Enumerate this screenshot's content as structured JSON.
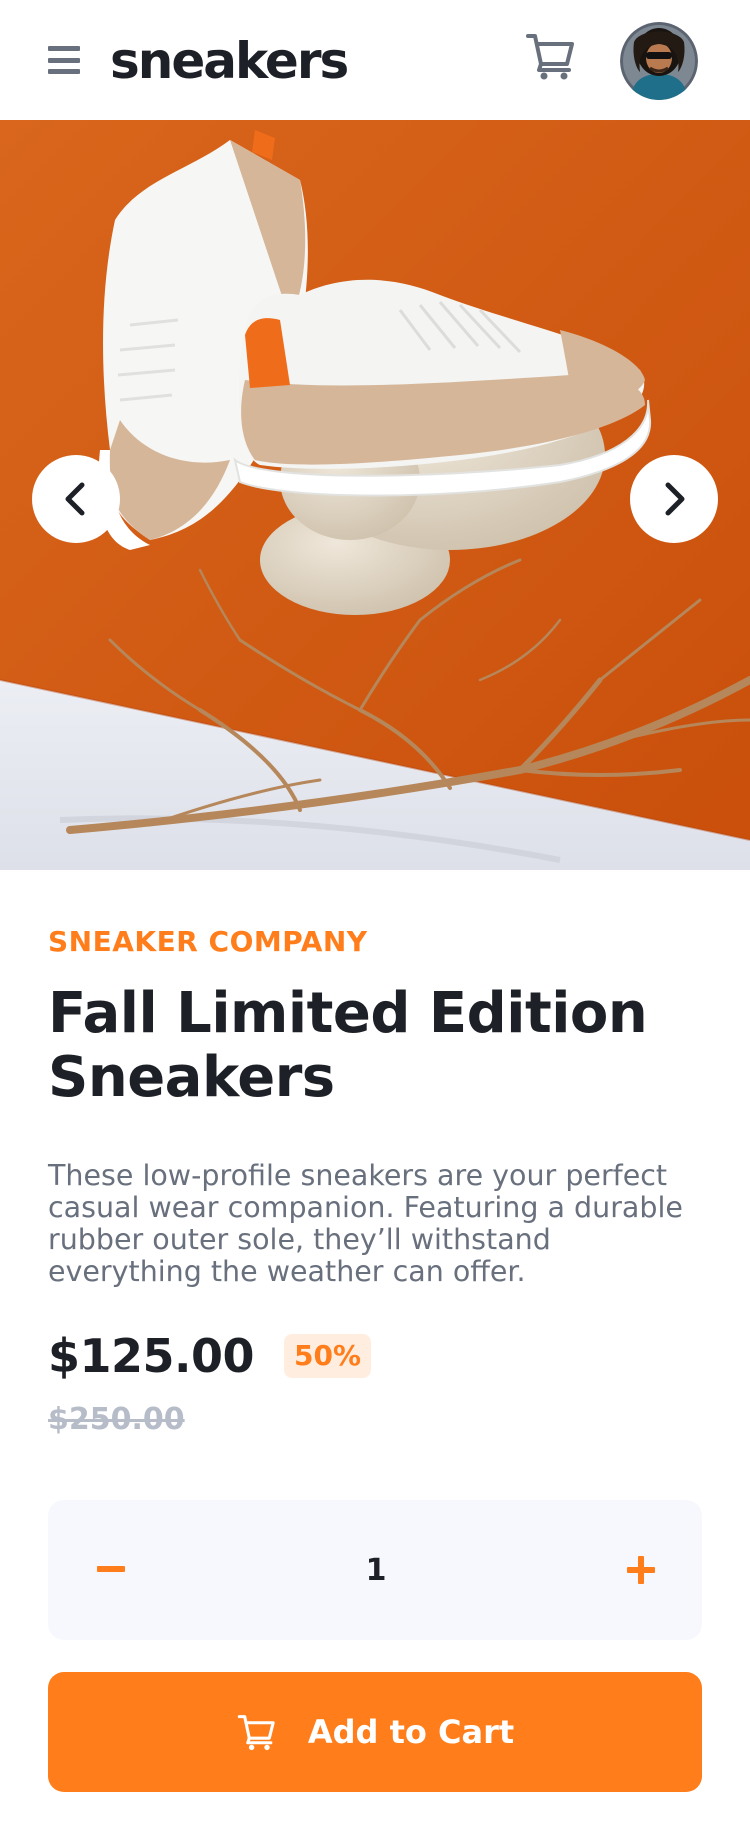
{
  "header": {
    "logo": "sneakers",
    "menu_icon": "hamburger-menu-icon",
    "cart_icon": "cart-icon"
  },
  "gallery": {
    "prev_icon": "chevron-left-icon",
    "next_icon": "chevron-right-icon"
  },
  "product": {
    "company": "SNEAKER COMPANY",
    "title": "Fall Limited Edition Sneakers",
    "description": "These low-profile sneakers are your perfect casual wear companion. Featuring a durable rubber outer sole, they’ll withstand everything the weather can offer.",
    "price": "$125.00",
    "discount": "50%",
    "old_price": "$250.00"
  },
  "quantity": {
    "value": "1",
    "minus_icon": "minus-icon",
    "plus_icon": "plus-icon"
  },
  "cta": {
    "label": "Add to Cart",
    "icon": "cart-icon"
  },
  "colors": {
    "accent": "#ff7e1b",
    "accent_pale": "#ffede0",
    "text_dark": "#1d2026",
    "text_gray": "#69707d",
    "text_light": "#b6bcc8",
    "panel_bg": "#f6f8fd"
  }
}
